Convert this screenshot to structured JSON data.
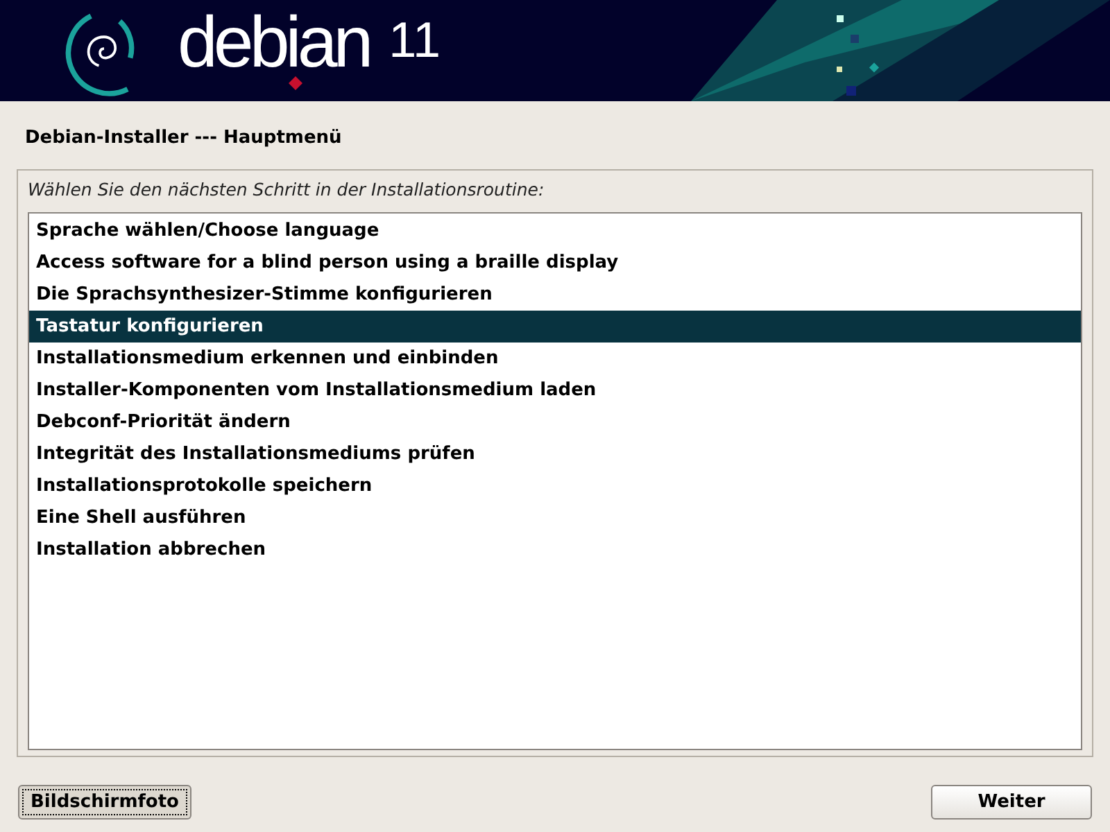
{
  "banner": {
    "wordmark": "debian",
    "version": "11"
  },
  "window": {
    "title": "Debian-Installer --- Hauptmenü"
  },
  "prompt": "Wählen Sie den nächsten Schritt in der Installationsroutine:",
  "menu_items": [
    {
      "label": "Sprache wählen/Choose language",
      "selected": false
    },
    {
      "label": "Access software for a blind person using a braille display",
      "selected": false
    },
    {
      "label": "Die Sprachsynthesizer-Stimme konfigurieren",
      "selected": false
    },
    {
      "label": "Tastatur konfigurieren",
      "selected": true
    },
    {
      "label": "Installationsmedium erkennen und einbinden",
      "selected": false
    },
    {
      "label": "Installer-Komponenten vom Installationsmedium laden",
      "selected": false
    },
    {
      "label": "Debconf-Priorität ändern",
      "selected": false
    },
    {
      "label": "Integrität des Installationsmediums prüfen",
      "selected": false
    },
    {
      "label": "Installationsprotokolle speichern",
      "selected": false
    },
    {
      "label": "Eine Shell ausführen",
      "selected": false
    },
    {
      "label": "Installation abbrechen",
      "selected": false
    }
  ],
  "buttons": [
    {
      "label": "Bildschirmfoto",
      "focused": true
    },
    {
      "label": "Weiter",
      "focused": false
    }
  ]
}
